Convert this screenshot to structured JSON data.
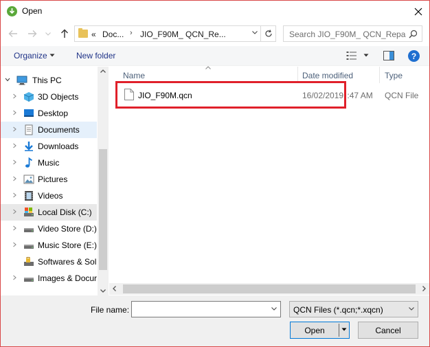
{
  "window": {
    "title": "Open"
  },
  "address": {
    "breadcrumbs": [
      "«",
      "Doc...",
      "JIO_F90M_  QCN_Re..."
    ],
    "search_placeholder": "Search JIO_F90M_  QCN_Repa..."
  },
  "toolbar": {
    "organize_label": "Organize",
    "new_folder_label": "New folder",
    "help_label": "?"
  },
  "navpane": {
    "items": [
      {
        "label": "This PC",
        "icon": "pc-icon"
      },
      {
        "label": "3D Objects",
        "icon": "3d-objects-icon"
      },
      {
        "label": "Desktop",
        "icon": "desktop-icon"
      },
      {
        "label": "Documents",
        "icon": "documents-icon"
      },
      {
        "label": "Downloads",
        "icon": "downloads-icon"
      },
      {
        "label": "Music",
        "icon": "music-icon"
      },
      {
        "label": "Pictures",
        "icon": "pictures-icon"
      },
      {
        "label": "Videos",
        "icon": "videos-icon"
      },
      {
        "label": "Local Disk (C:)",
        "icon": "local-disk-icon"
      },
      {
        "label": "Video Store (D:)",
        "icon": "drive-icon"
      },
      {
        "label": "Music Store (E:)",
        "icon": "drive-icon"
      },
      {
        "label": "Softwares & Solu",
        "icon": "locked-drive-icon"
      },
      {
        "label": "Images & Docur",
        "icon": "drive-icon"
      }
    ],
    "selected_item": "Documents",
    "hovered_item": "Local Disk (C:)"
  },
  "filelist": {
    "columns": [
      "Name",
      "Date modified",
      "Type"
    ],
    "files": [
      {
        "name": "JIO_F90M.qcn",
        "date": "16/02/2019 ",
        "time_fragment": ":47 AM",
        "type": "QCN File"
      }
    ]
  },
  "bottom": {
    "file_name_label": "File name:",
    "file_name_value": "",
    "filter_value": "QCN Files (*.qcn;*.xqcn)",
    "open_label": "Open",
    "cancel_label": "Cancel"
  },
  "colors": {
    "accent": "#0078d7",
    "highlight_box": "#e0202a",
    "selected_bg": "#e5f0fb",
    "link": "#1e3287"
  }
}
